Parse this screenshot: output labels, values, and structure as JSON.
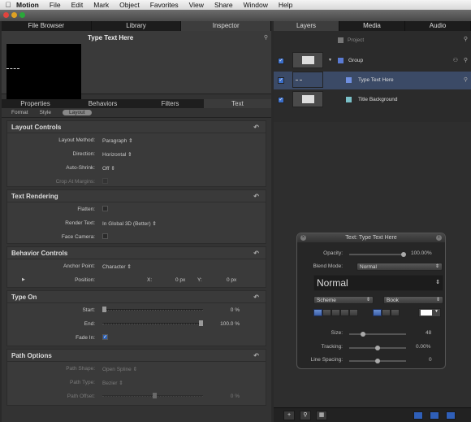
{
  "menubar": {
    "app": "Motion",
    "items": [
      "File",
      "Edit",
      "Mark",
      "Object",
      "Favorites",
      "View",
      "Share",
      "Window",
      "Help"
    ]
  },
  "left_tabs": [
    "File Browser",
    "Library",
    "Inspector"
  ],
  "preview_title": "Type Text Here",
  "inspector_tabs": [
    "Properties",
    "Behaviors",
    "Filters",
    "Text"
  ],
  "text_subtabs": [
    "Format",
    "Style",
    "Layout"
  ],
  "layout_controls": {
    "title": "Layout Controls",
    "layout_method_label": "Layout Method:",
    "layout_method_value": "Paragraph",
    "direction_label": "Direction:",
    "direction_value": "Horizontal",
    "auto_shrink_label": "Auto-Shrink:",
    "auto_shrink_value": "Off",
    "crop_label": "Crop At Margins:"
  },
  "text_rendering": {
    "title": "Text Rendering",
    "flatten_label": "Flatten:",
    "render_text_label": "Render Text:",
    "render_text_value": "In Global 3D (Better)",
    "face_camera_label": "Face Camera:"
  },
  "behavior_controls": {
    "title": "Behavior Controls",
    "anchor_label": "Anchor Point:",
    "anchor_value": "Character",
    "position_label": "Position:",
    "x_label": "X:",
    "x_value": "0 px",
    "y_label": "Y:",
    "y_value": "0 px"
  },
  "type_on": {
    "title": "Type On",
    "start_label": "Start:",
    "start_value": "0 %",
    "start_fraction": 0.0,
    "end_label": "End:",
    "end_value": "100.0 %",
    "end_fraction": 1.0,
    "fade_label": "Fade In:"
  },
  "path_options": {
    "title": "Path Options",
    "shape_label": "Path Shape:",
    "shape_value": "Open Spline",
    "type_label": "Path Type:",
    "type_value": "Bezier",
    "offset_label": "Path Offset:",
    "offset_value": "0 %"
  },
  "right_tabs": [
    "Layers",
    "Media",
    "Audio"
  ],
  "layers": {
    "project": "Project",
    "group": "Group",
    "text_layer": "Type Text Here",
    "background": "Title Background"
  },
  "hud": {
    "title": "Text: Type Text Here",
    "opacity_label": "Opacity:",
    "opacity_value": "100.00%",
    "blend_label": "Blend Mode:",
    "blend_value": "Normal",
    "font_name": "Normal",
    "collection": "Scheme",
    "typeface": "Book",
    "size_label": "Size:",
    "size_value": "48",
    "tracking_label": "Tracking:",
    "tracking_value": "0.00%",
    "line_spacing_label": "Line Spacing:",
    "line_spacing_value": "0"
  },
  "colors": {
    "accent": "#3b6ec8",
    "panel": "#333333",
    "selected_row": "#3b4a66"
  }
}
